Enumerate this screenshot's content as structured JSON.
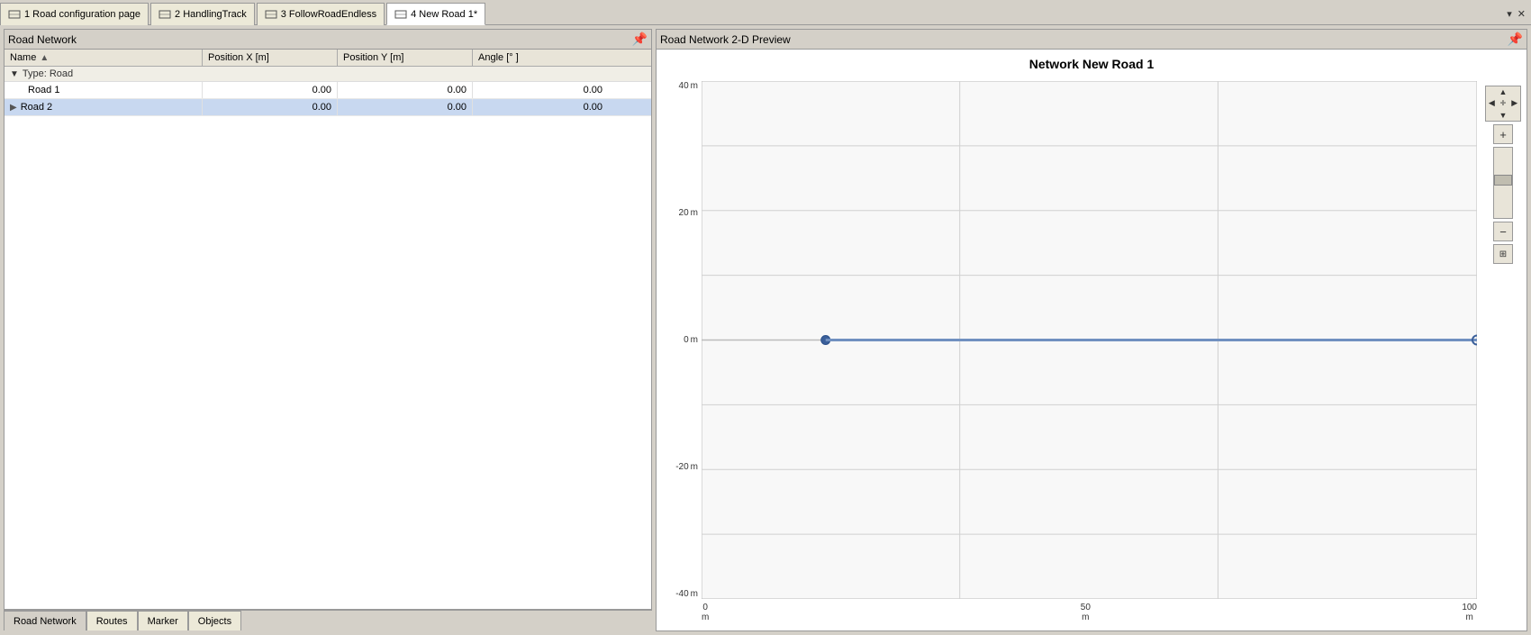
{
  "tabs": [
    {
      "id": "tab1",
      "icon": "road-icon",
      "label": "1 Road configuration page",
      "active": false
    },
    {
      "id": "tab2",
      "icon": "road-icon",
      "label": "2 HandlingTrack",
      "active": false
    },
    {
      "id": "tab3",
      "icon": "road-icon",
      "label": "3 FollowRoadEndless",
      "active": false
    },
    {
      "id": "tab4",
      "icon": "road-icon",
      "label": "4 New Road 1*",
      "active": true
    }
  ],
  "leftPanel": {
    "title": "Road Network",
    "columns": [
      {
        "label": "Name",
        "sortable": true
      },
      {
        "label": "Position X [m]"
      },
      {
        "label": "Position Y [m]"
      },
      {
        "label": "Angle [° ]"
      }
    ],
    "groupLabel": "Type: Road",
    "rows": [
      {
        "name": "Road 1",
        "posX": "0.00",
        "posY": "0.00",
        "angle": "0.00",
        "selected": false,
        "active": false
      },
      {
        "name": "Road 2",
        "posX": "0.00",
        "posY": "0.00",
        "angle": "0.00",
        "selected": true,
        "active": true
      }
    ]
  },
  "bottomTabs": [
    {
      "label": "Road Network",
      "active": true
    },
    {
      "label": "Routes",
      "active": false
    },
    {
      "label": "Marker",
      "active": false
    },
    {
      "label": "Objects",
      "active": false
    }
  ],
  "rightPanel": {
    "title": "Road Network 2-D Preview",
    "networkTitle": "Network New Road 1",
    "yLabels": [
      {
        "value": "40",
        "unit": "m"
      },
      {
        "value": "20",
        "unit": "m"
      },
      {
        "value": "0",
        "unit": "m"
      },
      {
        "value": "-20",
        "unit": "m"
      },
      {
        "value": "-40",
        "unit": "m"
      }
    ],
    "xLabels": [
      {
        "value": "0",
        "unit": "m"
      },
      {
        "value": "50",
        "unit": "m"
      },
      {
        "value": "100",
        "unit": "m"
      }
    ]
  }
}
